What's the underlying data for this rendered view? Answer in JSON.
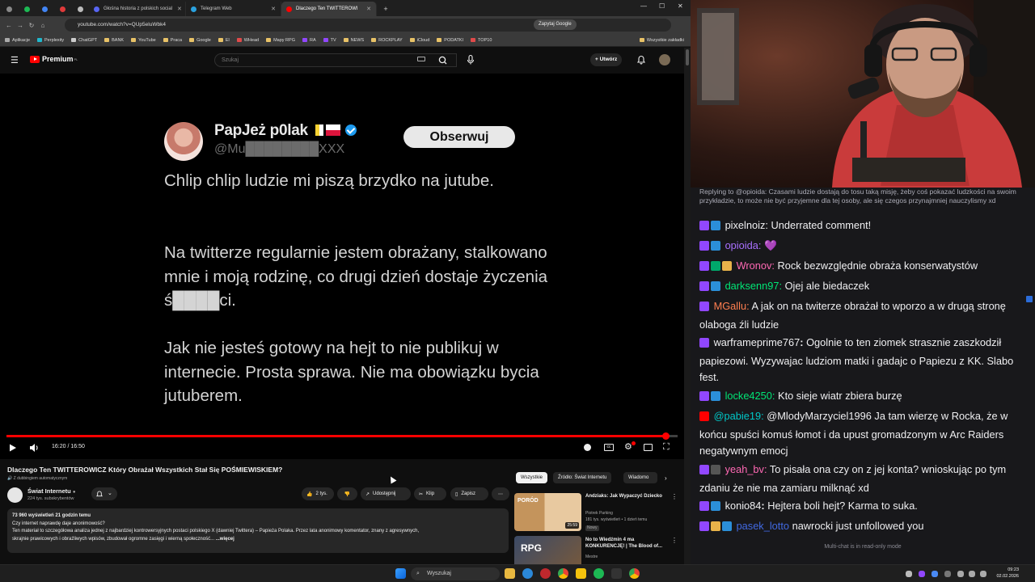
{
  "browser": {
    "tabs": [
      {
        "label": "Głośna historia z polskich social",
        "favicon_color": "#5865f2"
      },
      {
        "label": "Telegram Web",
        "favicon_color": "#2aa1de"
      },
      {
        "label": "Dlaczego Ten TWITTEROWI",
        "favicon_color": "#ff0000"
      }
    ],
    "url": "youtube.com/watch?v=QUp5eluWbk4",
    "ask_google": "Zapytaj Google",
    "bookmarks": [
      "Aplikacje",
      "Perplexity",
      "ChatGPT",
      "BANK",
      "YouTube",
      "Praca",
      "Google",
      "El",
      "WHead",
      "Mapy RPG",
      "RA",
      "TV",
      "NEWS",
      "ROCKPLAY",
      "iCloud",
      "PODATKI",
      "TOP10"
    ],
    "all_bookmarks": "Wszystkie zakładki"
  },
  "youtube": {
    "logo_text": "Premium",
    "logo_sup": "PL",
    "search_placeholder": "Szukaj",
    "create_label": "Utwórz"
  },
  "tweet": {
    "name": "PapJeż p0lak",
    "handle": "@Mu████████XXX",
    "follow_label": "Obserwuj",
    "paragraphs": [
      "Chlip chlip ludzie mi piszą brzydko na jutube.",
      "Na twitterze regularnie jestem obrażany, stalkowano mnie i moją rodzinę, co drugi dzień dostaje życzenia ś████ci.",
      "Jak nie jesteś gotowy na hejt to nie publikuj w internecie. Prosta sprawa. Nie ma obowiązku bycia jutuberem."
    ]
  },
  "player": {
    "time": "16:20 / 16:50",
    "progress": 0.9822
  },
  "video": {
    "title": "Dlaczego Ten TWITTEROWICZ Który Obrażał Wszystkich Stał Się POŚMIEWISKIEM?",
    "dub_label": "Z dubbingiem automatycznym",
    "channel": "Świat Internetu",
    "subscribers": "224 tys. subskrybentów",
    "likes": "2 tys.",
    "share": "Udostępnij",
    "clip": "Klip",
    "save": "Zapisz",
    "desc_meta": "73 960 wyświetleń  21 godzin temu",
    "desc_line1": "Czy internet naprawdę daje anonimowość?",
    "desc_line2": "Ten materiał to szczegółowa analiza jednej z najbardziej kontrowersyjnych postaci polskiego X (dawniej Twittera) – Papieża Polaka. Przez lata anonimowy komentator, znany z agresywnych,",
    "desc_line3": "skrajnie prawicowych i obraźliwych wpisów, zbudował ogromne zasięgi i wierną społeczność...",
    "desc_more": "...więcej"
  },
  "related": {
    "chips": [
      "Wszystkie",
      "Źródło: Świat Internetu",
      "Wiadomo"
    ],
    "items": [
      {
        "title": "Andziaks: Jak Wypaczyć Dziecko",
        "channel": "Piotrek Parking",
        "meta": "181 tys. wyświetleń • 1 dzień temu",
        "badge": "Nowy",
        "duration": "25:59",
        "thumb_text": "PORÓD"
      },
      {
        "title": "No to Wiedźmin 4 ma KONKURENCJĘ! | The Blood of...",
        "channel": "Mestre",
        "meta": "",
        "badge": "",
        "duration": "",
        "thumb_text": "RPG"
      }
    ]
  },
  "chat": {
    "reply": "Replying to @opioida: Czasami ludzie dostają do tosu taką misję, żeby coś pokazać ludzkości na swoim przykładzie, to może nie być przyjemne dla tej osoby, ale się czegos przynajmniej nauczylismy xd",
    "messages": [
      {
        "user": "pixelnoiz",
        "color": "#efeff1",
        "text": "Underrated comment!",
        "badges": [
          "twitch",
          "sub"
        ]
      },
      {
        "user": "opioida",
        "color": "#a970ff",
        "text": "💜",
        "badges": [
          "twitch",
          "sub"
        ]
      },
      {
        "user": "Wronov",
        "color": "#ff69b4",
        "text": "Rock bezwzględnie obraża konserwatystów",
        "badges": [
          "twitch",
          "green",
          "gift"
        ]
      },
      {
        "user": "darksenn97",
        "color": "#00e676",
        "text": "Ojej ale biedaczek",
        "badges": [
          "twitch",
          "sub"
        ]
      },
      {
        "user": "MGallu",
        "color": "#ff7f50",
        "text": "A jak on na twiterze obrażał to wporzo a w drugą stronę olaboga źli ludzie",
        "badges": [
          "twitch"
        ]
      },
      {
        "user": "warframeprime767",
        "color": "#efeff1",
        "text": "Ogolnie to ten ziomek strasznie zaszkodził papiezowi. Wyzywajac ludziom matki i gadajc o Papiezu z KK. Slabo fest.",
        "badges": [
          "twitch"
        ]
      },
      {
        "user": "locke4250",
        "color": "#00e676",
        "text": "Kto sieje wiatr zbiera burzę",
        "badges": [
          "twitch",
          "sub"
        ]
      },
      {
        "user": "@pabie19",
        "color": "#00c8c8",
        "text": "@MlodyMarzyciel1996 Ja tam wierzę w Rocka, że w końcu spuści komuś łomot i da upust gromadzonym w Arc Raiders negatywnym emocj",
        "badges": [
          "yt"
        ]
      },
      {
        "user": "yeah_bv",
        "color": "#ff69b4",
        "text": "To pisała ona czy on z jej konta? wnioskując po tym zdaniu że nie ma zamiaru milknąć xd",
        "badges": [
          "twitch",
          "wolf"
        ]
      },
      {
        "user": "konio84",
        "color": "#efeff1",
        "text": "Hejtera boli hejt? Karma to suka.",
        "badges": [
          "twitch",
          "sub"
        ]
      },
      {
        "user": "pasek_lotto",
        "color": "#4169e1",
        "text": "nawrocki just unfollowed you",
        "badges": [
          "twitch",
          "gift",
          "sub"
        ]
      }
    ],
    "footer": "Multi-chat is in read-only mode"
  },
  "taskbar": {
    "search": "Wyszukaj",
    "time": "09:23",
    "date": "02.02.2026"
  }
}
